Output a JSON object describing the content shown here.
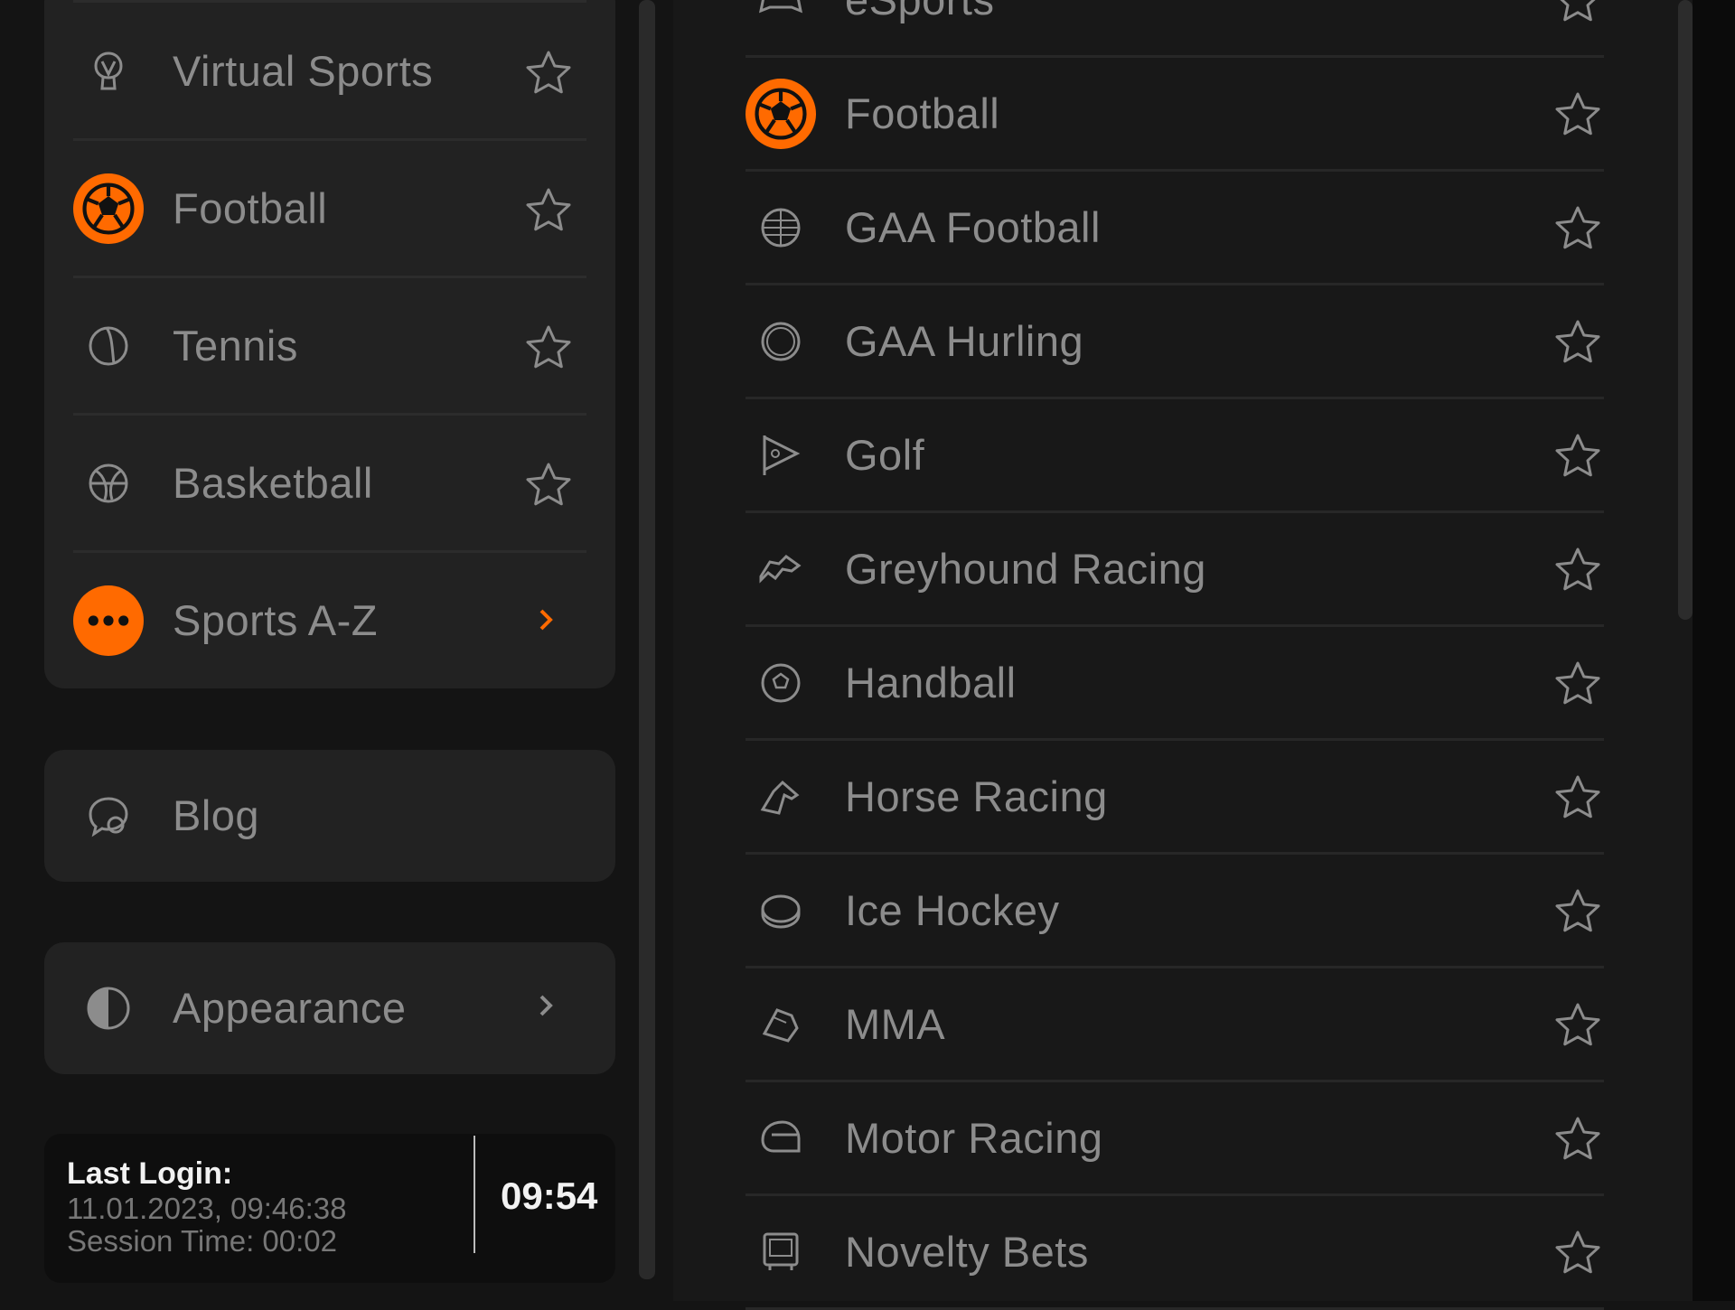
{
  "colors": {
    "accent": "#ff6a00",
    "background": "#141414",
    "card": "#222222",
    "text": "#8c8c8c"
  },
  "left_menu": {
    "items": [
      {
        "label": "Virtual Sports",
        "icon": "virtual-sports-icon",
        "action": "star-icon"
      },
      {
        "label": "Football",
        "icon": "football-icon",
        "highlighted": true,
        "action": "star-icon"
      },
      {
        "label": "Tennis",
        "icon": "tennis-ball-icon",
        "action": "star-icon"
      },
      {
        "label": "Basketball",
        "icon": "basketball-icon",
        "action": "star-icon"
      },
      {
        "label": "Sports A-Z",
        "icon": "more-dots-icon",
        "highlighted": true,
        "action": "chevron-right-icon"
      }
    ],
    "blog": {
      "label": "Blog",
      "icon": "blog-chat-icon"
    },
    "appearance": {
      "label": "Appearance",
      "icon": "contrast-icon"
    }
  },
  "session": {
    "last_login_label": "Last Login:",
    "last_login_value": "11.01.2023, 09:46:38",
    "session_time": "Session Time: 00:02",
    "clock": "09:54"
  },
  "sports_az": {
    "items": [
      {
        "label": "eSports",
        "icon": "gamepad-icon"
      },
      {
        "label": "Football",
        "icon": "football-icon",
        "highlighted": true
      },
      {
        "label": "GAA Football",
        "icon": "gaa-ball-icon"
      },
      {
        "label": "GAA Hurling",
        "icon": "sliotar-icon"
      },
      {
        "label": "Golf",
        "icon": "golf-flag-icon"
      },
      {
        "label": "Greyhound Racing",
        "icon": "greyhound-icon"
      },
      {
        "label": "Handball",
        "icon": "handball-icon"
      },
      {
        "label": "Horse Racing",
        "icon": "horse-icon"
      },
      {
        "label": "Ice Hockey",
        "icon": "puck-icon"
      },
      {
        "label": "MMA",
        "icon": "glove-icon"
      },
      {
        "label": "Motor Racing",
        "icon": "helmet-icon"
      },
      {
        "label": "Novelty Bets",
        "icon": "tv-icon"
      }
    ]
  }
}
